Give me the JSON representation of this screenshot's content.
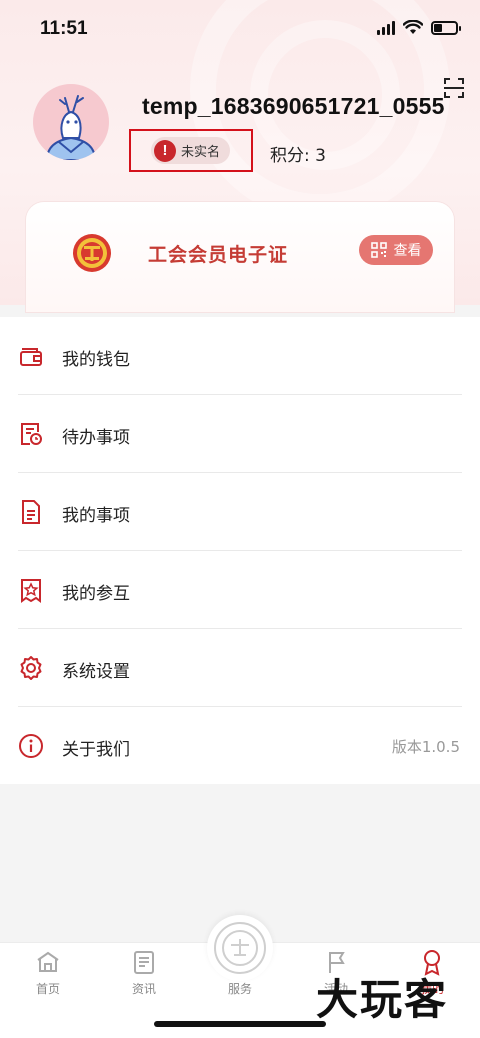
{
  "status_bar": {
    "time": "11:51"
  },
  "profile": {
    "username": "temp_1683690651721_0555",
    "verify_label": "未实名",
    "points_text": "积分: 3"
  },
  "member_card": {
    "title": "工会会员电子证",
    "view_label": "查看"
  },
  "menu": {
    "items": [
      {
        "label": "我的钱包",
        "icon": "wallet-icon"
      },
      {
        "label": "待办事项",
        "icon": "todo-clock-icon"
      },
      {
        "label": "我的事项",
        "icon": "document-icon"
      },
      {
        "label": "我的参互",
        "icon": "star-badge-icon"
      },
      {
        "label": "系统设置",
        "icon": "gear-icon"
      },
      {
        "label": "关于我们",
        "icon": "info-icon",
        "extra": "版本1.0.5"
      }
    ]
  },
  "tabbar": {
    "tabs": [
      {
        "label": "首页",
        "icon": "home-icon"
      },
      {
        "label": "资讯",
        "icon": "news-icon"
      },
      {
        "label": "服务",
        "icon": "service-icon"
      },
      {
        "label": "活动",
        "icon": "flag-icon"
      },
      {
        "label": "我的",
        "icon": "profile-medal-icon",
        "active": true
      }
    ]
  },
  "watermark": "大玩客",
  "colors": {
    "accent": "#c8272c",
    "card_title": "#c53c35",
    "view_button": "#e57671"
  }
}
